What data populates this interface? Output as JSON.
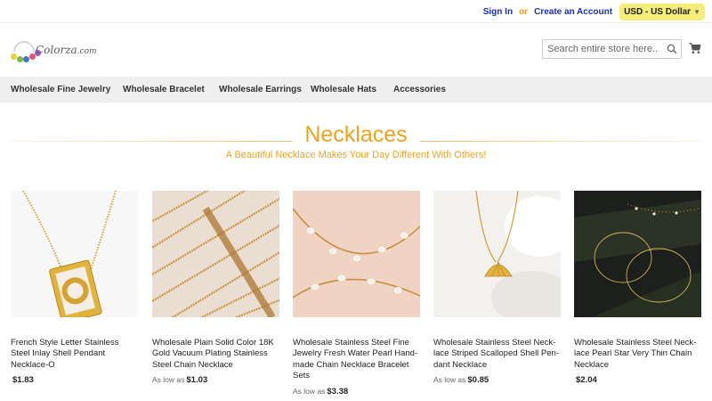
{
  "header": {
    "sign_in": "Sign In",
    "or": "or",
    "create_account": "Create an Account",
    "currency": "USD - US Dollar",
    "logo_text": "Colorza",
    "logo_suffix": ".com",
    "search_placeholder": "Search entire store here..."
  },
  "nav": {
    "items": [
      {
        "label": "Wholesale Fine Jewelry"
      },
      {
        "label": "Wholesale Bracelet"
      },
      {
        "label": "Wholesale Earrings"
      },
      {
        "label": "Wholesale Hats"
      },
      {
        "label": "Accessories"
      }
    ]
  },
  "page": {
    "title": "Necklaces",
    "subtitle": "A Beautiful Necklace Makes Your Day Different With Others!"
  },
  "products": [
    {
      "name": "French Style Letter Stainless Steel Inlay Shell Pendant Necklace-O",
      "price_prefix": "",
      "price": "$1.83"
    },
    {
      "name": "Wholesale Plain Solid Color 18K Gold Vacuum Plating Stainless Steel Chain Necklace",
      "price_prefix": "As low as",
      "price": "$1.03"
    },
    {
      "name": "Wholesale Stainless Steel Fine Jewelry Fresh Water Pearl Hand-made Chain Necklace Bracelet Sets",
      "price_prefix": "As low as",
      "price": "$3.38"
    },
    {
      "name": "Wholesale Stainless Steel Neck-lace Striped Scalloped Shell Pen-dant Necklace",
      "price_prefix": "As low as",
      "price": "$0.85"
    },
    {
      "name": "Wholesale Stainless Steel Neck-lace Pearl Star Very Thin Chain Necklace",
      "price_prefix": "",
      "price": "$2.04"
    }
  ],
  "colors": {
    "accent": "#f0a21e",
    "link": "#1a2db5",
    "currency_bg": "#f4ed7a",
    "nav_bg": "#efefef"
  },
  "icons": [
    "chevron-down-icon",
    "search-icon",
    "cart-icon"
  ]
}
